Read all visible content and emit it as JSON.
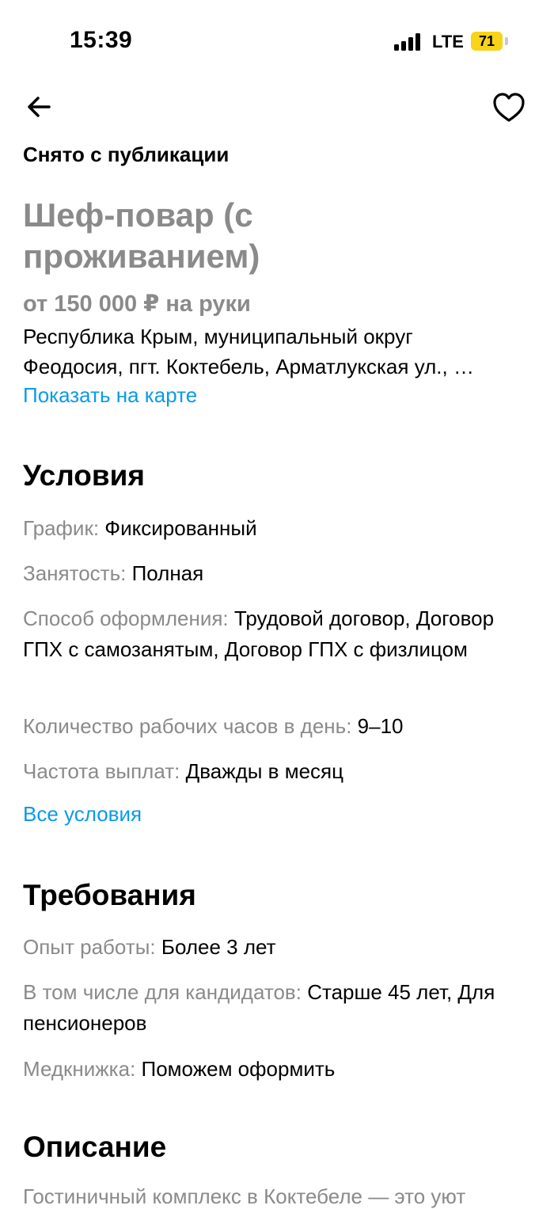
{
  "status_bar": {
    "time": "15:39",
    "network": "LTE",
    "battery": "71",
    "battery_color": "#f7d31a"
  },
  "header": {
    "back_icon": "arrow-left-icon",
    "favorite_icon": "heart-outline-icon"
  },
  "listing": {
    "status": "Снято с публикации",
    "title": "Шеф-повар (с проживанием)",
    "salary": "от 150 000 ₽ на руки",
    "address_line1": "Республика Крым, муниципальный округ",
    "address_line2": "Феодосия, пгт. Коктебель, Арматлукская ул., …",
    "map_link": "Показать на карте"
  },
  "conditions": {
    "title": "Условия",
    "rows": [
      {
        "label": "График:",
        "value": "Фиксированный"
      },
      {
        "label": "Занятость:",
        "value": "Полная"
      },
      {
        "label": "Способ оформления:",
        "value": "Трудовой договор, Договор ГПХ с самозанятым, Договор ГПХ с физлицом"
      },
      {
        "label": "Количество рабочих часов в день:",
        "value": "9–10"
      },
      {
        "label": "Частота выплат:",
        "value": "Дважды в месяц"
      }
    ],
    "all_link": "Все условия"
  },
  "requirements": {
    "title": "Требования",
    "rows": [
      {
        "label": "Опыт работы:",
        "value": "Более 3 лет"
      },
      {
        "label": "В том числе для кандидатов:",
        "value": "Старше 45 лет, Для пенсионеров"
      },
      {
        "label": "Медкнижка:",
        "value": "Поможем оформить"
      }
    ]
  },
  "description": {
    "title": "Описание",
    "text_start": "Гостиничный комплекс в Коктебеле — это уют"
  },
  "colors": {
    "accent_link": "#0a9ae8",
    "muted": "#8a8a8a"
  }
}
